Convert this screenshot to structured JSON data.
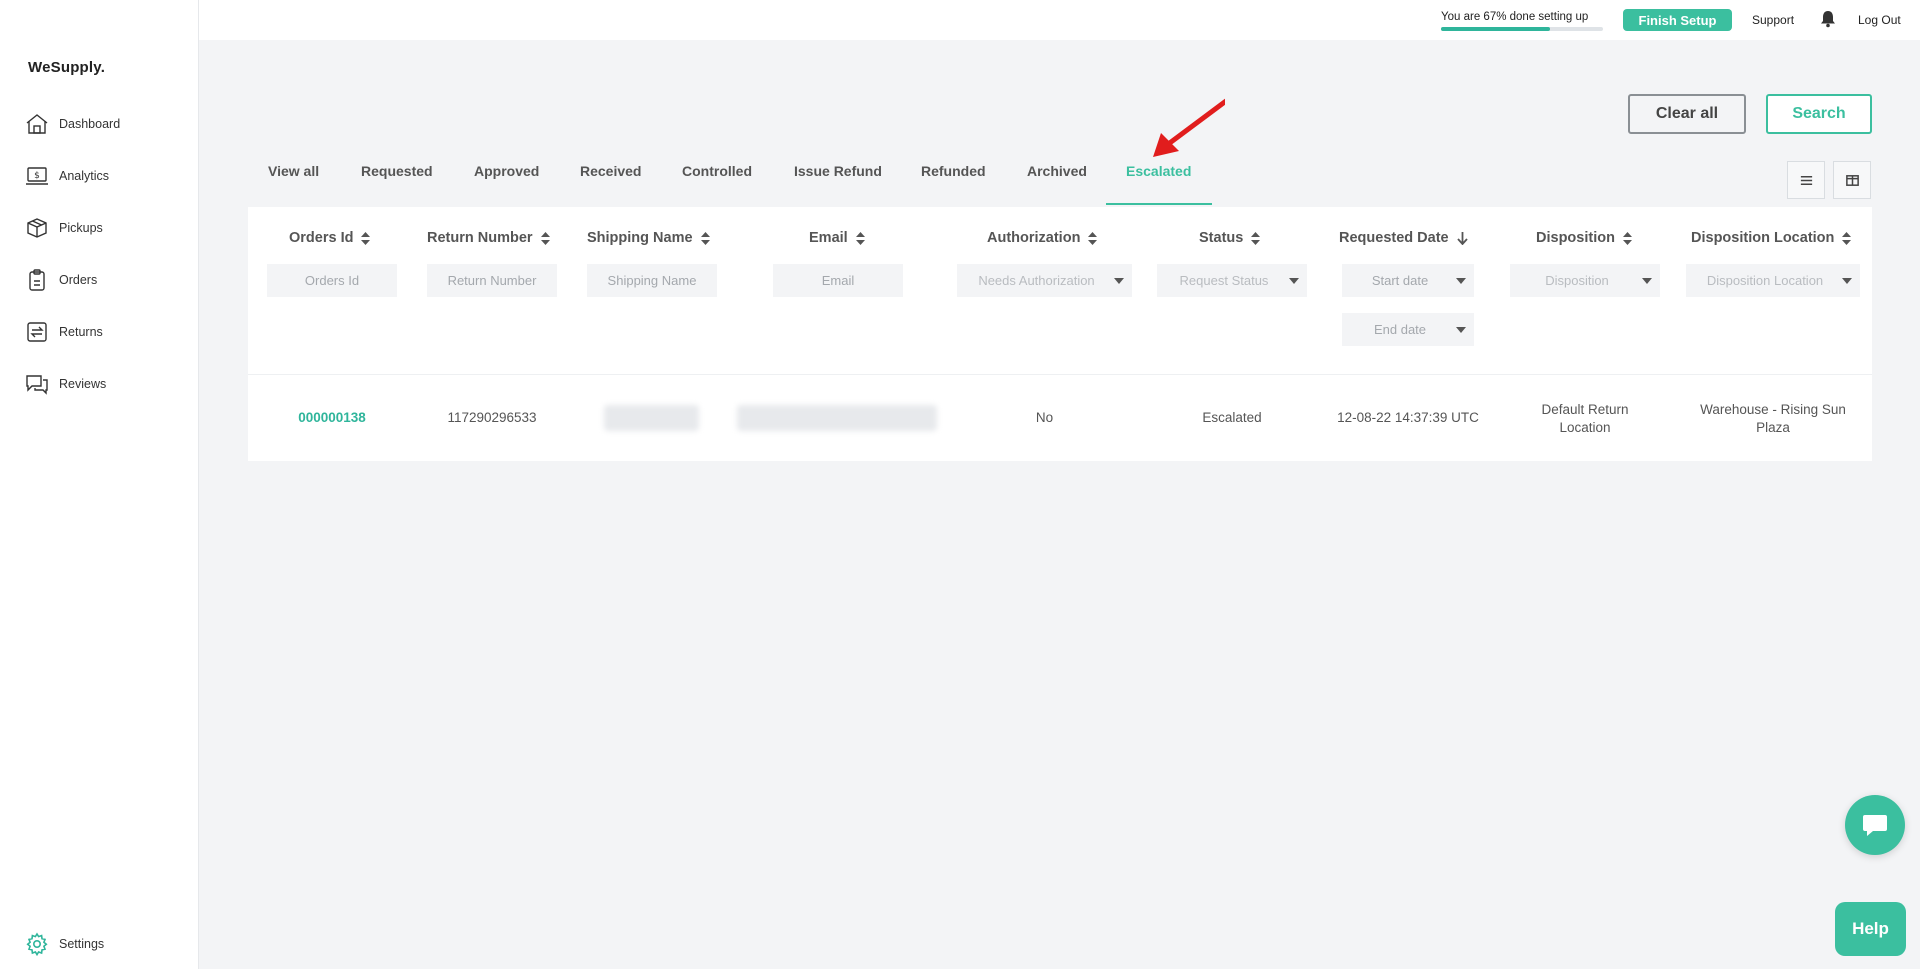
{
  "brand": {
    "name": "WeSupply."
  },
  "sidebar": {
    "items": [
      {
        "label": "Dashboard",
        "icon": "home-icon"
      },
      {
        "label": "Analytics",
        "icon": "analytics-icon"
      },
      {
        "label": "Pickups",
        "icon": "box-icon"
      },
      {
        "label": "Orders",
        "icon": "clipboard-icon"
      },
      {
        "label": "Returns",
        "icon": "returns-icon"
      },
      {
        "label": "Reviews",
        "icon": "reviews-icon"
      }
    ],
    "settings": {
      "label": "Settings",
      "icon": "gear-icon"
    }
  },
  "topbar": {
    "setup_text": "You are 67% done setting up",
    "setup_progress": 0.67,
    "finish_label": "Finish Setup",
    "support_label": "Support",
    "bell_icon": "bell-icon",
    "logout_label": "Log Out"
  },
  "actions": {
    "clear_label": "Clear all",
    "search_label": "Search"
  },
  "tabs": {
    "items": [
      "View all",
      "Requested",
      "Approved",
      "Received",
      "Controlled",
      "Issue Refund",
      "Refunded",
      "Archived",
      "Escalated"
    ],
    "active": "Escalated"
  },
  "table": {
    "headers": [
      "Orders Id",
      "Return Number",
      "Shipping Name",
      "Email",
      "Authorization",
      "Status",
      "Requested Date",
      "Disposition",
      "Disposition Location"
    ],
    "filters": {
      "orders_id": "Orders Id",
      "return_number": "Return Number",
      "shipping_name": "Shipping Name",
      "email": "Email",
      "authorization": "Needs Authorization",
      "status": "Request Status",
      "start_date": "Start date",
      "end_date": "End date",
      "disposition": "Disposition",
      "disposition_location": "Disposition Location"
    },
    "rows": [
      {
        "orders_id": "000000138",
        "return_number": "117290296533",
        "authorization": "No",
        "status": "Escalated",
        "requested_date": "12-08-22 14:37:39 UTC",
        "disposition": "Default Return Location",
        "disposition_location": "Warehouse - Rising Sun Plaza"
      }
    ]
  },
  "floating": {
    "chat_icon": "chat-icon",
    "help_label": "Help"
  },
  "colors": {
    "accent": "#3bbf9f",
    "annotation_arrow": "#e11d1d"
  }
}
